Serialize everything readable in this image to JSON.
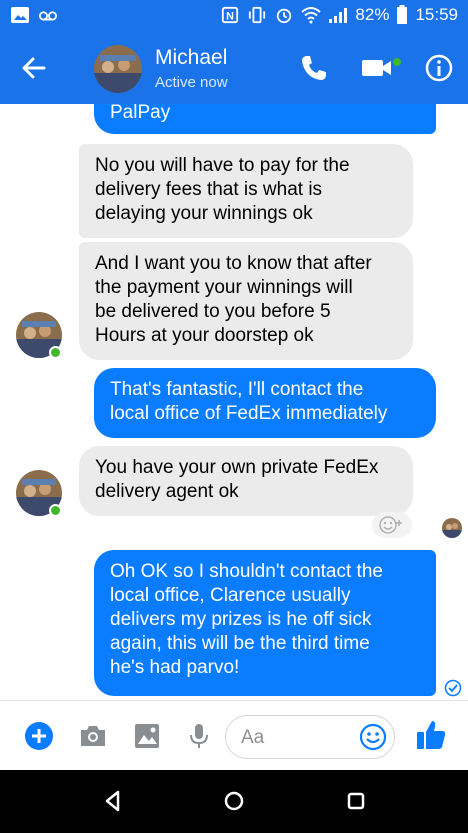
{
  "status_bar": {
    "battery_percent": "82%",
    "time": "15:59",
    "icons": [
      "image-notification-icon",
      "voicemail-icon",
      "nfc-icon",
      "vibrate-icon",
      "alarm-icon",
      "wifi-icon",
      "signal-icon",
      "battery-icon"
    ]
  },
  "header": {
    "contact_name": "Michael",
    "contact_status": "Active now",
    "icons": [
      "back-arrow-icon",
      "phone-icon",
      "video-icon",
      "info-icon"
    ]
  },
  "messages": [
    {
      "direction": "outgoing",
      "text": "PalPay",
      "partial": true
    },
    {
      "direction": "incoming",
      "text": "No you will have to pay for the\ndelivery fees that is what is\ndelaying your winnings ok"
    },
    {
      "direction": "incoming",
      "text": "And I want you to know that after\nthe payment your winnings will\nbe delivered to you before 5\nHours at your doorstep ok"
    },
    {
      "direction": "outgoing",
      "text": "That's fantastic, I'll contact the\nlocal office of FedEx immediately"
    },
    {
      "direction": "incoming",
      "text": "You have your own private FedEx\ndelivery agent ok"
    },
    {
      "direction": "outgoing",
      "text": "Oh OK so I shouldn't contact the\nlocal office, Clarence usually\ndelivers my prizes is he off sick\nagain, this will be the third time\nhe's had parvo!"
    }
  ],
  "composer": {
    "placeholder": "Aa",
    "icons": [
      "plus-icon",
      "camera-icon",
      "gallery-icon",
      "microphone-icon",
      "emoji-icon",
      "thumbs-up-icon"
    ]
  },
  "colors": {
    "brand_blue": "#1a73e8",
    "outgoing_bubble": "#0a7cff",
    "incoming_bubble": "#ebebeb",
    "online_green": "#42b72a"
  }
}
